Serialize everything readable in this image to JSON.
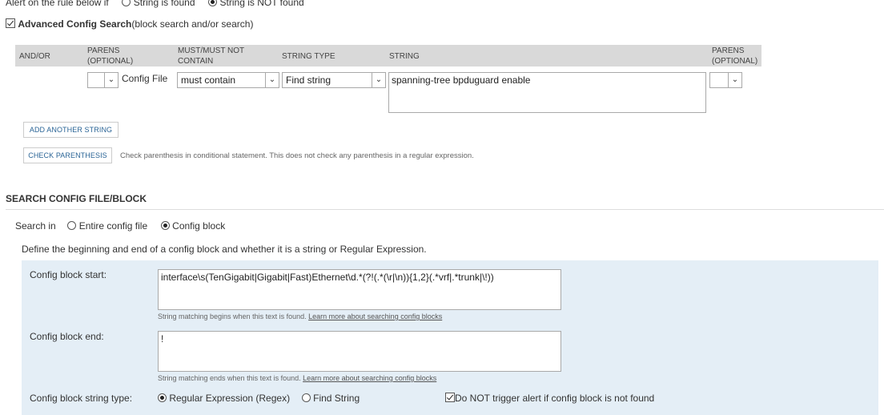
{
  "top_alert": {
    "prefix": "Alert on the rule below if",
    "option_found": "String is found",
    "option_not_found": "String is NOT found"
  },
  "advanced": {
    "title": "Advanced Config Search",
    "subtitle": "(block search and/or search)"
  },
  "table": {
    "headers": {
      "and_or": "AND/OR",
      "parens_open_1": "PARENS",
      "parens_open_2": "(OPTIONAL)",
      "must_1": "MUST/MUST NOT",
      "must_2": "CONTAIN",
      "string_type": "STRING TYPE",
      "string": "STRING",
      "parens_close_1": "PARENS",
      "parens_close_2": "(OPTIONAL)"
    },
    "row": {
      "parens_open_value": "",
      "source_label": "Config File",
      "must_value": "must contain",
      "type_value": "Find string",
      "string_value": "spanning-tree bpduguard enable",
      "parens_close_value": ""
    }
  },
  "buttons": {
    "add_string": "ADD ANOTHER STRING",
    "check_paren": "CHECK PARENTHESIS",
    "check_paren_hint": "Check parenthesis in conditional statement. This does not check any parenthesis in a regular expression."
  },
  "search_block": {
    "section_title": "SEARCH CONFIG FILE/BLOCK",
    "search_in_label": "Search in",
    "option_entire": "Entire config file",
    "option_block": "Config block",
    "define_text": "Define the beginning and end of a config block and whether it is a string or Regular Expression.",
    "start_label": "Config block start:",
    "start_value": "interface\\s(TenGigabit|Gigabit|Fast)Ethernet\\d.*(?!(.*(\\r|\\n)){1,2}(.*vrf|.*trunk|\\!))",
    "start_hint": "String matching begins when this text is found.",
    "start_link": "Learn more about searching config blocks",
    "end_label": "Config block end:",
    "end_value": "!",
    "end_hint": "String matching ends when this text is found.",
    "end_link": "Learn more about searching config blocks",
    "type_label": "Config block string type:",
    "option_regex": "Regular Expression (Regex)",
    "option_find": "Find String",
    "no_trigger": "Do NOT trigger alert if config block is not found"
  },
  "colors": {
    "table_header_bg": "#d9d9d9",
    "block_panel_bg": "#e4eef6",
    "link_blue": "#2a6496"
  }
}
